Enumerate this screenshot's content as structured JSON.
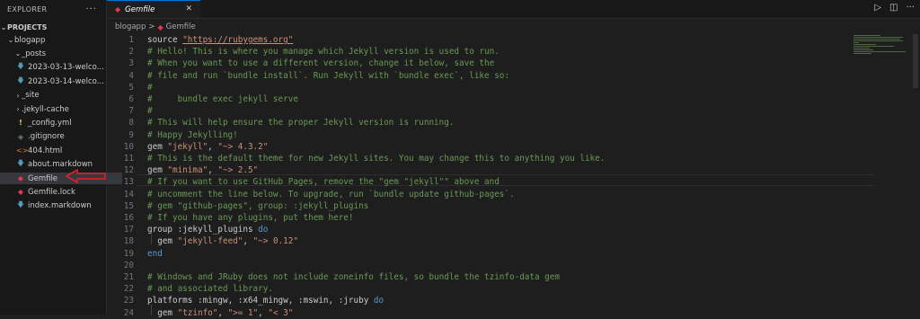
{
  "explorer": {
    "title": "EXPLORER",
    "more": "···",
    "section": "PROJECTS",
    "items": [
      {
        "label": "blogapp",
        "chev": "⌄",
        "icon": "",
        "cls": ""
      },
      {
        "label": "_posts",
        "chev": "⌄",
        "icon": "",
        "cls": ""
      },
      {
        "label": "2023-03-13-welco...",
        "chev": "",
        "icon": "🡇",
        "cls": "ic-dl"
      },
      {
        "label": "2023-03-14-welco...",
        "chev": "",
        "icon": "🡇",
        "cls": "ic-dl"
      },
      {
        "label": "_site",
        "chev": "›",
        "icon": "",
        "cls": ""
      },
      {
        "label": ".jekyll-cache",
        "chev": "›",
        "icon": "",
        "cls": ""
      },
      {
        "label": "_config.yml",
        "chev": "",
        "icon": "!",
        "cls": "ic-excl"
      },
      {
        "label": ".gitignore",
        "chev": "",
        "icon": "◈",
        "cls": "ic-git"
      },
      {
        "label": "404.html",
        "chev": "",
        "icon": "<>",
        "cls": "ic-html"
      },
      {
        "label": "about.markdown",
        "chev": "",
        "icon": "🡇",
        "cls": "ic-md"
      },
      {
        "label": "Gemfile",
        "chev": "",
        "icon": "◆",
        "cls": "ic-ruby"
      },
      {
        "label": "Gemfile.lock",
        "chev": "",
        "icon": "◆",
        "cls": "ic-ruby"
      },
      {
        "label": "index.markdown",
        "chev": "",
        "icon": "🡇",
        "cls": "ic-md"
      }
    ]
  },
  "tab": {
    "label": "Gemfile",
    "close": "✕"
  },
  "actions": {
    "run": "▷",
    "split": "◫",
    "more": "···"
  },
  "breadcrumb": {
    "folder": "blogapp",
    "sep": ">",
    "file": "Gemfile"
  },
  "code_lines": [
    [
      {
        "t": "source ",
        "c": "t-sym"
      },
      {
        "t": "\"https://rubygems.org\"",
        "c": "t-url"
      }
    ],
    [
      {
        "t": "# Hello! This is where you manage which Jekyll version is used to run.",
        "c": "t-com"
      }
    ],
    [
      {
        "t": "# When you want to use a different version, change it below, save the",
        "c": "t-com"
      }
    ],
    [
      {
        "t": "# file and run `bundle install`. Run Jekyll with `bundle exec`, like so:",
        "c": "t-com"
      }
    ],
    [
      {
        "t": "#",
        "c": "t-com"
      }
    ],
    [
      {
        "t": "#     bundle exec jekyll serve",
        "c": "t-com"
      }
    ],
    [
      {
        "t": "#",
        "c": "t-com"
      }
    ],
    [
      {
        "t": "# This will help ensure the proper Jekyll version is running.",
        "c": "t-com"
      }
    ],
    [
      {
        "t": "# Happy Jekylling!",
        "c": "t-com"
      }
    ],
    [
      {
        "t": "gem ",
        "c": "t-sym"
      },
      {
        "t": "\"jekyll\"",
        "c": "t-str"
      },
      {
        "t": ", ",
        "c": "t-sym"
      },
      {
        "t": "\"~> 4.3.2\"",
        "c": "t-str"
      }
    ],
    [
      {
        "t": "# This is the default theme for new Jekyll sites. You may change this to anything you like.",
        "c": "t-com"
      }
    ],
    [
      {
        "t": "gem ",
        "c": "t-sym"
      },
      {
        "t": "\"minima\"",
        "c": "t-str"
      },
      {
        "t": ", ",
        "c": "t-sym"
      },
      {
        "t": "\"~> 2.5\"",
        "c": "t-str"
      }
    ],
    [
      {
        "t": "# If you want to use GitHub Pages, remove the \"gem \"jekyll\"\" above and",
        "c": "t-com"
      }
    ],
    [
      {
        "t": "# uncomment the line below. To upgrade, run `bundle update github-pages`.",
        "c": "t-com"
      }
    ],
    [
      {
        "t": "# gem \"github-pages\", group: :jekyll_plugins",
        "c": "t-com"
      }
    ],
    [
      {
        "t": "# If you have any plugins, put them here!",
        "c": "t-com"
      }
    ],
    [
      {
        "t": "group ",
        "c": "t-sym"
      },
      {
        "t": ":jekyll_plugins ",
        "c": "t-sym"
      },
      {
        "t": "do",
        "c": "t-kw"
      }
    ],
    [
      {
        "t": "  gem ",
        "c": "t-sym"
      },
      {
        "t": "\"jekyll-feed\"",
        "c": "t-str"
      },
      {
        "t": ", ",
        "c": "t-sym"
      },
      {
        "t": "\"~> 0.12\"",
        "c": "t-str"
      }
    ],
    [
      {
        "t": "end",
        "c": "t-kw"
      }
    ],
    [],
    [
      {
        "t": "# Windows and JRuby does not include zoneinfo files, so bundle the tzinfo-data gem",
        "c": "t-com"
      }
    ],
    [
      {
        "t": "# and associated library.",
        "c": "t-com"
      }
    ],
    [
      {
        "t": "platforms ",
        "c": "t-sym"
      },
      {
        "t": ":mingw, :x64_mingw, :mswin, :jruby ",
        "c": "t-sym"
      },
      {
        "t": "do",
        "c": "t-kw"
      }
    ],
    [
      {
        "t": "  gem ",
        "c": "t-sym"
      },
      {
        "t": "\"tzinfo\"",
        "c": "t-str"
      },
      {
        "t": ", ",
        "c": "t-sym"
      },
      {
        "t": "\">= 1\"",
        "c": "t-str"
      },
      {
        "t": ", ",
        "c": "t-sym"
      },
      {
        "t": "\"< 3\"",
        "c": "t-str"
      }
    ]
  ]
}
